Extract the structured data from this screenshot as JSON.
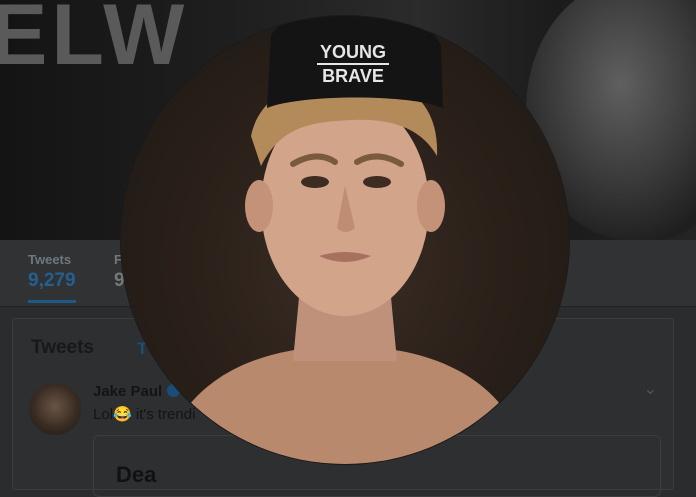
{
  "banner": {
    "text": "ELW"
  },
  "profile_nav": {
    "stats": [
      {
        "label": "Tweets",
        "value": "9,279"
      },
      {
        "label": "F",
        "value": "9"
      }
    ]
  },
  "timeline": {
    "title": "Tweets",
    "second_tab": "T",
    "tweet": {
      "author": "Jake Paul",
      "text": "Lol😂 it's trendi",
      "embed_title": "Dea"
    }
  },
  "profile_photo": {
    "cap_text_line1": "YOUNG",
    "cap_text_line2": "BRAVE"
  },
  "colors": {
    "accent": "#1da1f2",
    "dim_overlay": "#000000"
  }
}
